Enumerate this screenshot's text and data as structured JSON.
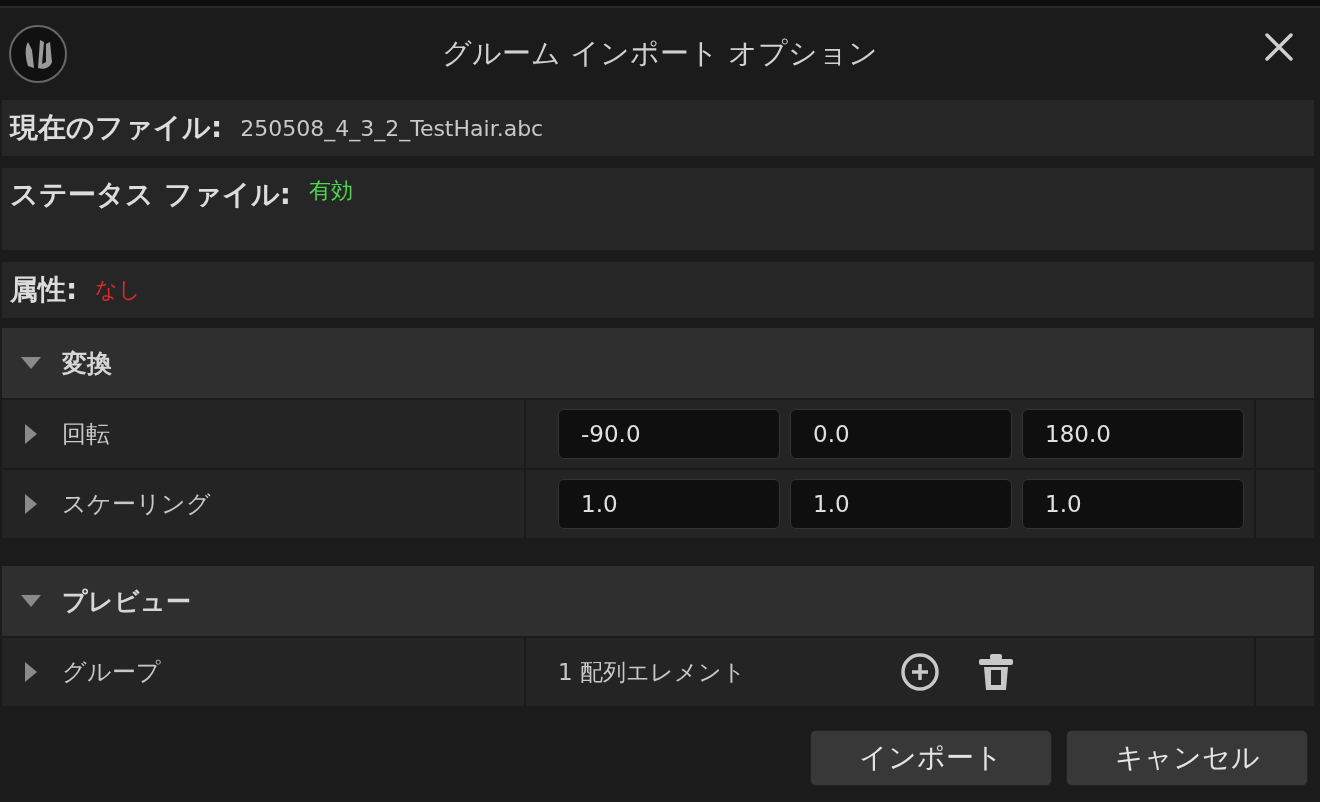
{
  "window": {
    "title": "グルーム インポート オプション"
  },
  "info_rows": [
    {
      "label": "現在のファイル:",
      "value": "250508_4_3_2_TestHair.abc"
    },
    {
      "label": "ステータス ファイル:",
      "value": "有効",
      "color": "#4fd64f"
    },
    {
      "label": "属性:",
      "value": "なし",
      "color": "#e02a2a"
    }
  ],
  "sections": [
    {
      "title": "変換",
      "expanded": true,
      "properties": [
        {
          "label": "回転",
          "expanded": false,
          "kind": "vector",
          "values": [
            "-90.0",
            "0.0",
            "180.0"
          ]
        },
        {
          "label": "スケーリング",
          "expanded": false,
          "kind": "vector",
          "values": [
            "1.0",
            "1.0",
            "1.0"
          ]
        }
      ]
    },
    {
      "title": "プレビュー",
      "expanded": true,
      "properties": [
        {
          "label": "グループ",
          "expanded": false,
          "kind": "array",
          "summary": "1 配列エレメント"
        }
      ]
    }
  ],
  "buttons": [
    "インポート",
    "キャンセル"
  ]
}
